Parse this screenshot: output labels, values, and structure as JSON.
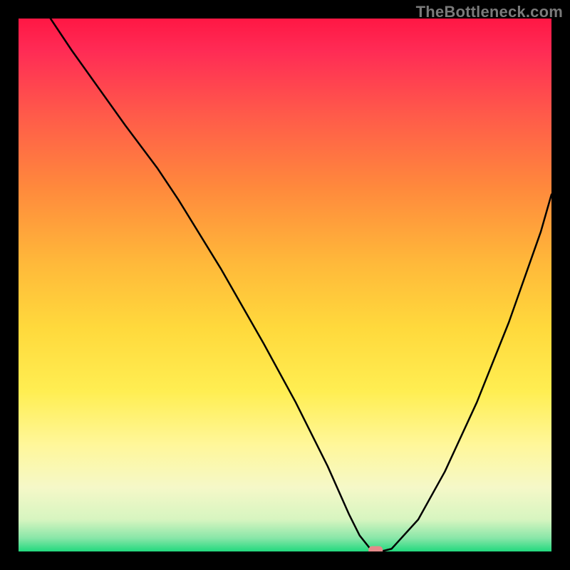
{
  "watermark": "TheBottleneck.com",
  "chart_data": {
    "type": "line",
    "title": "",
    "xlabel": "",
    "ylabel": "",
    "xlim": [
      0,
      100
    ],
    "ylim": [
      0,
      100
    ],
    "grid": false,
    "legend": false,
    "background": "red-yellow-green vertical gradient",
    "series": [
      {
        "name": "bottleneck-curve",
        "x": [
          6,
          10,
          20,
          26,
          30,
          38,
          46,
          52,
          58,
          62,
          64,
          66,
          68,
          70,
          75,
          80,
          86,
          92,
          98,
          100
        ],
        "y": [
          100,
          94,
          80,
          72,
          66,
          53,
          39,
          28,
          16,
          7,
          3,
          0.5,
          0,
          0.5,
          6,
          15,
          28,
          43,
          60,
          67
        ]
      }
    ],
    "annotations": [
      {
        "name": "optimal-marker",
        "x": 67,
        "y": 0.2,
        "shape": "rounded-rect",
        "color": "#e58a8a"
      }
    ],
    "gradient_stops": [
      {
        "offset": 0.0,
        "color": "#ff1744"
      },
      {
        "offset": 0.06,
        "color": "#ff2b55"
      },
      {
        "offset": 0.18,
        "color": "#ff5a4a"
      },
      {
        "offset": 0.32,
        "color": "#ff8a3c"
      },
      {
        "offset": 0.46,
        "color": "#ffb93a"
      },
      {
        "offset": 0.58,
        "color": "#ffd93c"
      },
      {
        "offset": 0.7,
        "color": "#ffee52"
      },
      {
        "offset": 0.8,
        "color": "#fff79a"
      },
      {
        "offset": 0.88,
        "color": "#f5f8c8"
      },
      {
        "offset": 0.94,
        "color": "#d7f5c0"
      },
      {
        "offset": 0.975,
        "color": "#88e6a8"
      },
      {
        "offset": 1.0,
        "color": "#22d97e"
      }
    ]
  }
}
